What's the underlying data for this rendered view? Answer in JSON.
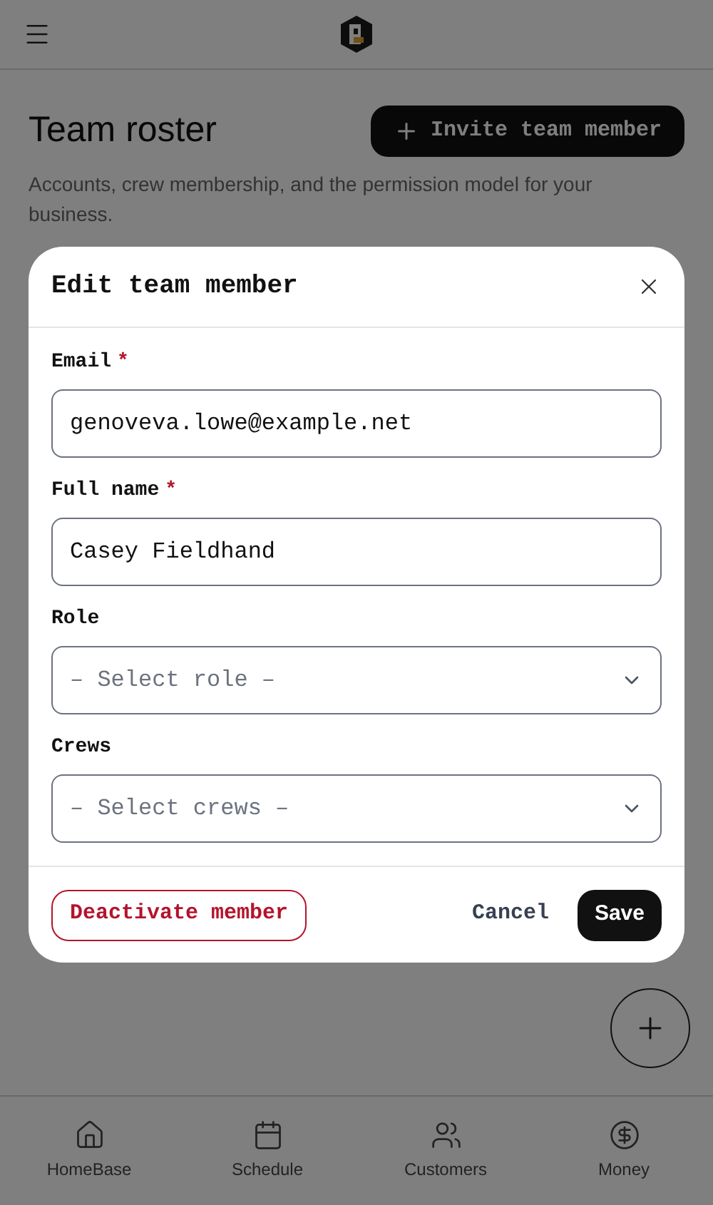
{
  "page": {
    "title": "Team roster",
    "subtitle": "Accounts, crew membership, and the permission model for your business.",
    "invite_button": "Invite team member"
  },
  "dialog": {
    "title": "Edit team member",
    "fields": [
      {
        "kind": "text",
        "label": "Email",
        "required_mark": "*",
        "value": "genoveva.lowe@example.net"
      },
      {
        "kind": "text",
        "label": "Full name",
        "required_mark": "*",
        "value": "Casey Fieldhand"
      },
      {
        "kind": "select",
        "label": "Role",
        "placeholder": "– Select role –"
      },
      {
        "kind": "select",
        "label": "Crews",
        "placeholder": "– Select crews –"
      }
    ],
    "deactivate_button": "Deactivate member",
    "cancel_button": "Cancel",
    "save_button": "Save"
  },
  "bottom_nav": [
    {
      "kind": "home",
      "label": "HomeBase"
    },
    {
      "kind": "calendar",
      "label": "Schedule"
    },
    {
      "kind": "people",
      "label": "Customers"
    },
    {
      "kind": "money",
      "label": "Money"
    }
  ]
}
